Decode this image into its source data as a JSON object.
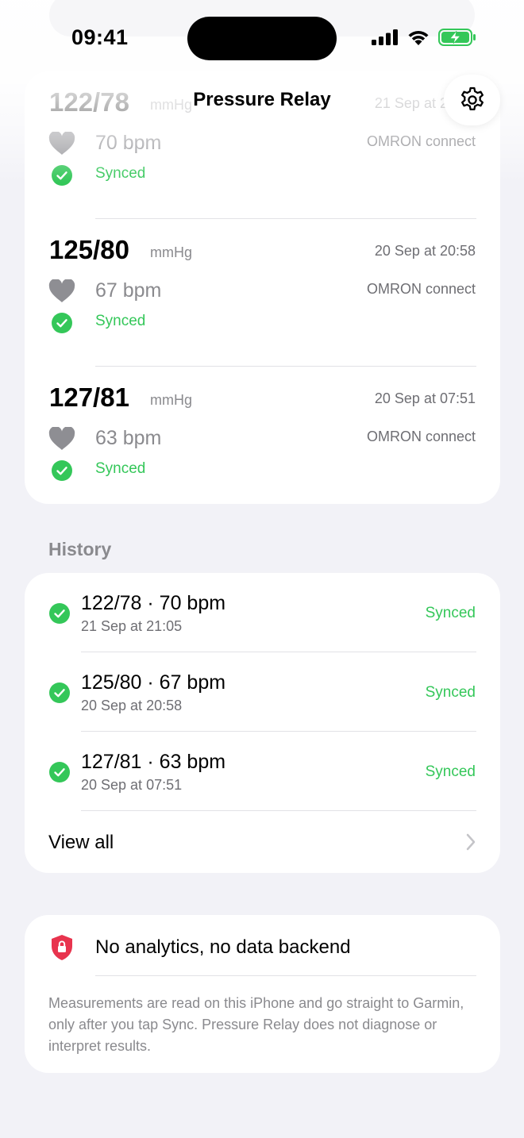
{
  "status_bar": {
    "time": "09:41"
  },
  "header": {
    "title": "Pressure Relay",
    "settings_icon": "gear-icon"
  },
  "readings": [
    {
      "bp": "122/78",
      "unit": "mmHg",
      "date": "21 Sep at 21:05",
      "bpm": "70 bpm",
      "source": "OMRON connect",
      "status": "Synced"
    },
    {
      "bp": "125/80",
      "unit": "mmHg",
      "date": "20 Sep at 20:58",
      "bpm": "67 bpm",
      "source": "OMRON connect",
      "status": "Synced"
    },
    {
      "bp": "127/81",
      "unit": "mmHg",
      "date": "20 Sep at 07:51",
      "bpm": "63 bpm",
      "source": "OMRON connect",
      "status": "Synced"
    }
  ],
  "history": {
    "label": "History",
    "items": [
      {
        "title": "122/78 · 70 bpm",
        "date": "21 Sep at 21:05",
        "status": "Synced"
      },
      {
        "title": "125/80 · 67 bpm",
        "date": "20 Sep at 20:58",
        "status": "Synced"
      },
      {
        "title": "127/81 · 63 bpm",
        "date": "20 Sep at 07:51",
        "status": "Synced"
      }
    ],
    "view_all": "View all"
  },
  "privacy": {
    "title": "No analytics, no data backend",
    "body": "Measurements are read on this iPhone and go straight to Garmin, only after you tap Sync. Pressure Relay does not diagnose or interpret results."
  },
  "colors": {
    "green": "#34c759",
    "red": "#e8344e",
    "gray": "#8a8a8e",
    "background": "#f2f2f7"
  }
}
